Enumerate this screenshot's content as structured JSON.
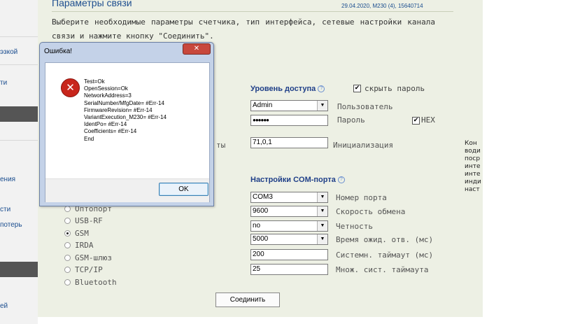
{
  "sidebar": {
    "items": [
      {
        "label": "эзкой"
      },
      {
        "label": "ти"
      },
      {
        "label": "ения"
      },
      {
        "label": "сти"
      },
      {
        "label": "потерь"
      },
      {
        "label": "ей"
      }
    ]
  },
  "page": {
    "title": "Параметры связи",
    "meter_info": "29.04.2020, M230 (4), 15640714",
    "description": "Выберите необходимые параметры счетчика, тип интерфейса, сетевые настройки канала связи и нажмите кнопку \"Соединить\"."
  },
  "access": {
    "heading": "Уровень доступа",
    "hide_password_label": "скрыть пароль",
    "hide_password_checked": true,
    "user_value": "Admin",
    "user_label": "Пользователь",
    "password_masked": "●●●●●●",
    "password_label": "Пароль",
    "hex_label": "HEX",
    "hex_checked": true,
    "left_label_fragment": "ты",
    "init_value": "71,0,1",
    "init_label": "Инициализация"
  },
  "interfaces": {
    "items": [
      {
        "label": "Оптопорт",
        "selected": false
      },
      {
        "label": "USB-RF",
        "selected": false
      },
      {
        "label": "GSM",
        "selected": true
      },
      {
        "label": "IRDA",
        "selected": false
      },
      {
        "label": "GSM-шлюз",
        "selected": false
      },
      {
        "label": "TCP/IP",
        "selected": false
      },
      {
        "label": "Bluetooth",
        "selected": false
      }
    ]
  },
  "com": {
    "heading": "Настройки COM-порта",
    "port_value": "COM3",
    "port_label": "Номер порта",
    "baud_value": "9600",
    "baud_label": "Скорость обмена",
    "parity_value": "no",
    "parity_label": "Четность",
    "wait_value": "5000",
    "wait_label": "Время ожид. отв. (мс)",
    "systimeout_value": "200",
    "systimeout_label": "Системн. таймаут (мс)",
    "multiplier_value": "25",
    "multiplier_label": "Множ. сист. таймаута"
  },
  "connect_button": "Соединить",
  "right_panel": {
    "text": "Кон\nводи\nпоср\nинте\nинте\nинди\nнаст"
  },
  "dialog": {
    "title": "Ошибка!",
    "close_glyph": "✕",
    "lines": [
      "Test=Ok",
      "OpenSession=Ok",
      "NetworkAddress=3",
      "SerialNumber/MfgDate= #Err-14",
      "FirmwareRevision= #Err-14",
      "VariantExecution_M230= #Err-14",
      "IdentPo= #Err-14",
      "Coefficients= #Err-14",
      "End"
    ],
    "ok_label": "OK"
  },
  "icons": {
    "dialog_icon": "error-icon",
    "help_icon": "help-circle-icon"
  },
  "colors": {
    "heading_blue": "#1f3f88",
    "panel_bg": "#edf0e4",
    "error_red": "#c8261c"
  }
}
